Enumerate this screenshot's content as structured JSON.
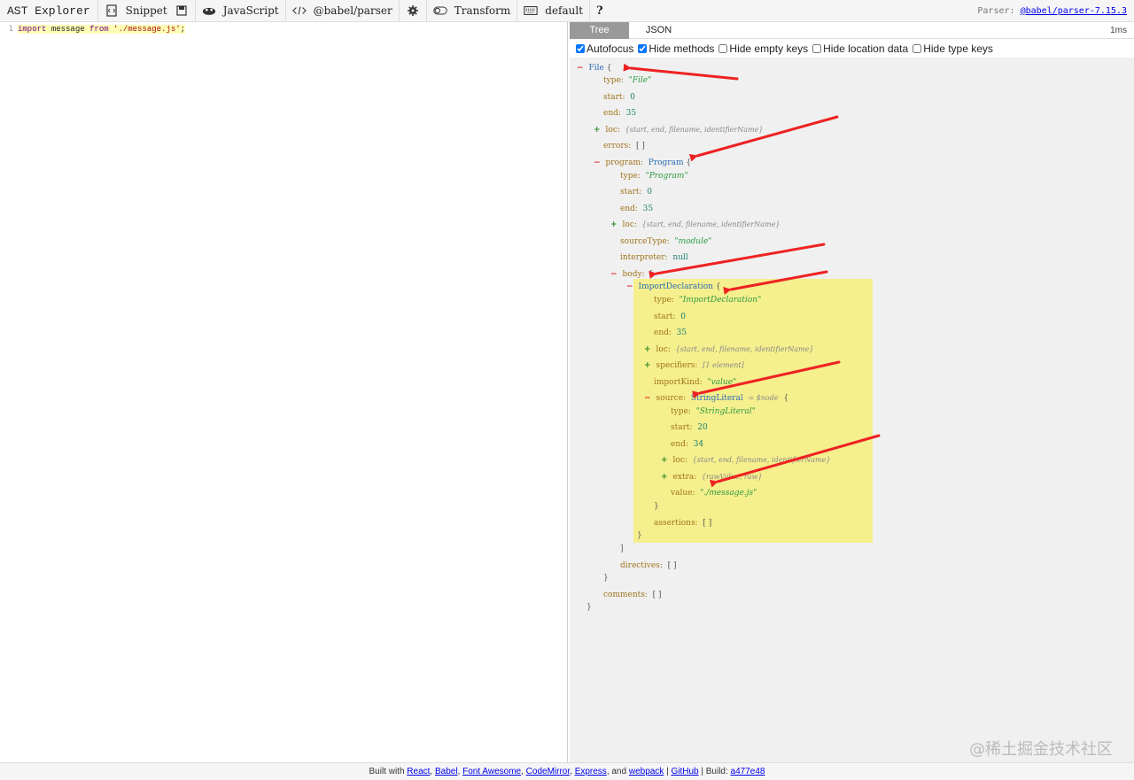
{
  "toolbar": {
    "brand": "AST Explorer",
    "snippet": "Snippet",
    "language": "JavaScript",
    "parser": "@babel/parser",
    "transform": "Transform",
    "keymap": "default",
    "help": "?",
    "parser_label": "Parser:",
    "parser_version": "@babel/parser-7.15.3"
  },
  "editor": {
    "line_number": "1",
    "code_kw1": "import",
    "code_id": "message",
    "code_kw2": "from",
    "code_str": "'./message.js'",
    "code_end": ";"
  },
  "output": {
    "tabs": [
      "Tree",
      "JSON"
    ],
    "time": "1ms",
    "options": [
      "Autofocus",
      "Hide methods",
      "Hide empty keys",
      "Hide location data",
      "Hide type keys"
    ],
    "options_checked": [
      true,
      true,
      false,
      false,
      false
    ]
  },
  "tree": {
    "file": "File",
    "type_key": "type:",
    "start_key": "start:",
    "end_key": "end:",
    "loc_key": "loc:",
    "errors_key": "errors:",
    "program_key": "program:",
    "sourcetype_key": "sourceType:",
    "interpreter_key": "interpreter:",
    "body_key": "body:",
    "specifiers_key": "specifiers:",
    "importkind_key": "importKind:",
    "source_key": "source:",
    "extra_key": "extra:",
    "value_key": "value:",
    "assertions_key": "assertions:",
    "directives_key": "directives:",
    "comments_key": "comments:",
    "file_type": "\"File\"",
    "program_type": "\"Program\"",
    "import_type": "\"ImportDeclaration\"",
    "string_type": "\"StringLiteral\"",
    "program_name": "Program",
    "import_name": "ImportDeclaration",
    "string_name": "StringLiteral",
    "node_ref": "= $node",
    "start_0": "0",
    "end_35": "35",
    "start_20": "20",
    "end_34": "34",
    "loc_summary": "{start, end, filename, identifierName}",
    "specifiers_summary": "[1 element]",
    "extra_summary": "{rawValue, raw}",
    "empty_arr": "[ ]",
    "module": "\"module\"",
    "null": "null",
    "import_kind": "\"value\"",
    "value_str": "\"./message.js\""
  },
  "footer": {
    "built_with": "Built with",
    "react": "React",
    "babel": "Babel",
    "font_awesome": "Font Awesome",
    "codemirror": "CodeMirror",
    "express": "Express",
    "and": ", and",
    "webpack": "webpack",
    "github": "GitHub",
    "build": "Build:",
    "build_hash": "a477e48"
  },
  "watermark": "@稀土掘金技术社区",
  "colors": {
    "arrow": "#ee2222",
    "highlight": "#f5ef8d",
    "tab_active": "#999999"
  }
}
